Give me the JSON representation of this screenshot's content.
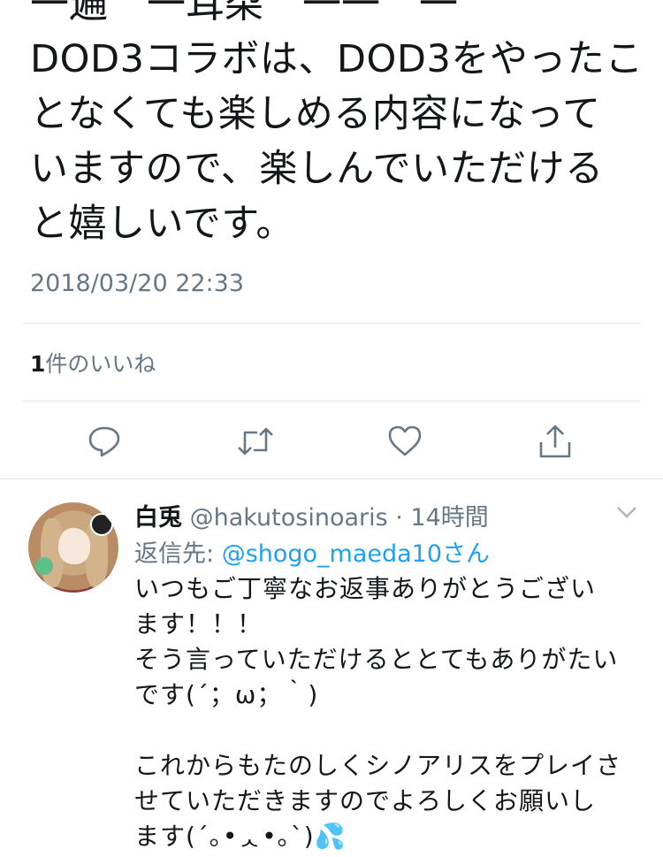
{
  "tweet": {
    "cutoff_line": "一遍　一耳朶　一一　一",
    "text_lines": [
      "DOD3コラボは、DOD3をやったこ",
      "となくても楽しめる内容になって",
      "いますので、楽しんでいただける",
      "と嬉しいです。"
    ],
    "timestamp": "2018/03/20 22:33",
    "likes_count": "1",
    "likes_label": "件のいいね"
  },
  "actions": {
    "icons": [
      "reply-icon",
      "retweet-icon",
      "like-icon",
      "share-icon"
    ]
  },
  "reply": {
    "display_name": "白兎",
    "handle_meta": "@hakutosinoaris · 14時間",
    "replying_prefix": "返信先: ",
    "replying_mention": "@shogo_maeda10さん",
    "body_lines": [
      "いつもご丁寧なお返事ありがとうござい",
      "ます！！！",
      "そう言っていただけるととてもありがたい",
      "です(´；ω；｀)",
      "",
      "これからもたのしくシノアリスをプレイさ",
      "せていただきますのでよろしくお願いし",
      "ます(´｡•ᆺ•｡`)💦"
    ]
  },
  "colors": {
    "text": "#14171a",
    "secondary": "#657786",
    "link": "#1da1f2",
    "divider": "#e1e8ed"
  }
}
